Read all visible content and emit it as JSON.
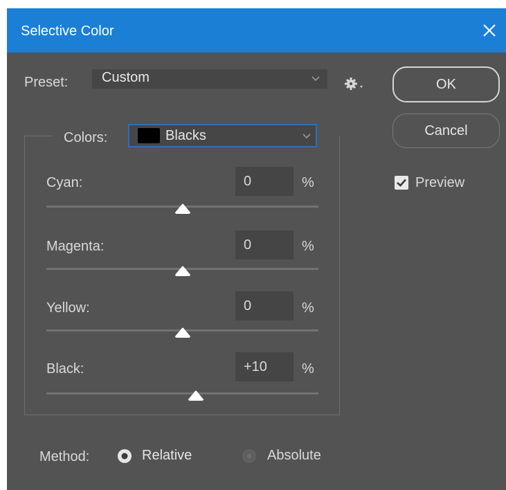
{
  "window": {
    "title": "Selective Color"
  },
  "preset": {
    "label": "Preset:",
    "value": "Custom"
  },
  "buttons": {
    "ok": "OK",
    "cancel": "Cancel"
  },
  "preview": {
    "label": "Preview",
    "checked": true
  },
  "colors": {
    "label": "Colors:",
    "value": "Blacks",
    "swatch": "#000000"
  },
  "sliders": [
    {
      "label": "Cyan:",
      "value": "0",
      "unit": "%",
      "level": 0
    },
    {
      "label": "Magenta:",
      "value": "0",
      "unit": "%",
      "level": 0
    },
    {
      "label": "Yellow:",
      "value": "0",
      "unit": "%",
      "level": 0
    },
    {
      "label": "Black:",
      "value": "+10",
      "unit": "%",
      "level": 10
    }
  ],
  "method": {
    "label": "Method:",
    "options": [
      "Relative",
      "Absolute"
    ],
    "selected": "Relative"
  },
  "theme": {
    "title_bar": "#1b7fd6",
    "panel": "#535353",
    "field": "#454545",
    "focus_border": "#2f6fb8"
  }
}
